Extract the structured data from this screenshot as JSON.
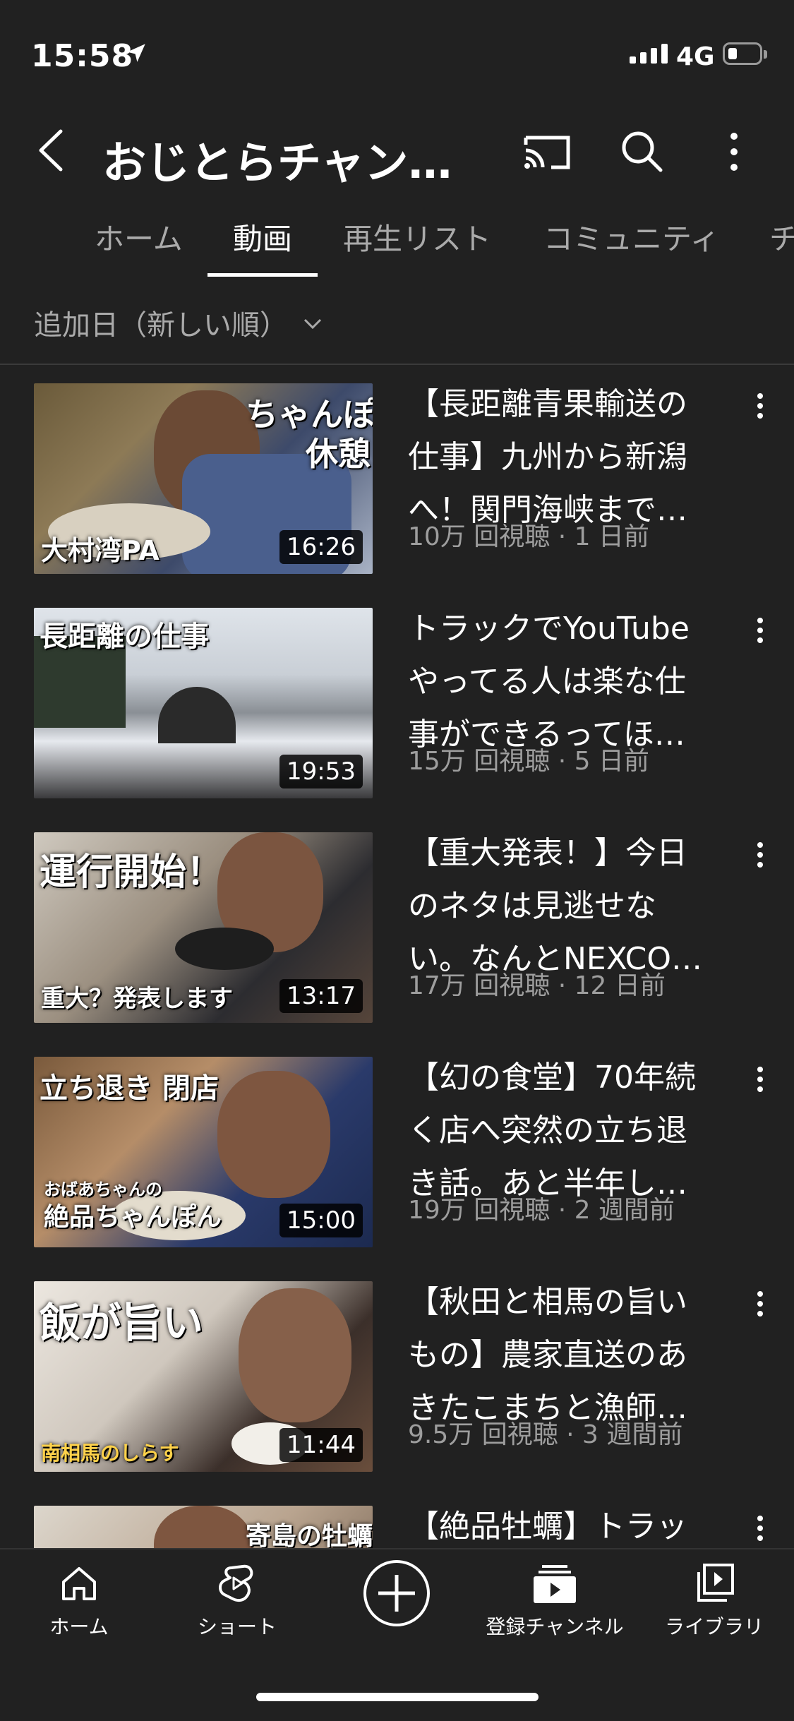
{
  "status_bar": {
    "time": "15:58",
    "network": "4G"
  },
  "header": {
    "title": "おじとらチャン…"
  },
  "tabs": [
    {
      "label": "ホーム"
    },
    {
      "label": "動画"
    },
    {
      "label": "再生リスト"
    },
    {
      "label": "コミュニティ"
    },
    {
      "label": "チ"
    }
  ],
  "active_tab": "動画",
  "sort": {
    "label": "追加日（新しい順）"
  },
  "videos": [
    {
      "title_lines": [
        "【長距離青果輸送の",
        "仕事】九州から新潟",
        "へ！関門海峡まで…"
      ],
      "meta": "10万 回視聴 · 1 日前",
      "duration": "16:26",
      "thumb_text": [
        "ちゃんぽん",
        "休憩",
        "大村湾PA"
      ]
    },
    {
      "title_lines": [
        "トラックでYouTube",
        "やってる人は楽な仕",
        "事ができるってほ…"
      ],
      "meta": "15万 回視聴 · 5 日前",
      "duration": "19:53",
      "thumb_text": [
        "長距離の仕事"
      ]
    },
    {
      "title_lines": [
        "【重大発表！】今日",
        "のネタは見逃せな",
        "い。なんとNEXCO…"
      ],
      "meta": "17万 回視聴 · 12 日前",
      "duration": "13:17",
      "thumb_text": [
        "運行開始！",
        "重大？発表します"
      ]
    },
    {
      "title_lines": [
        "【幻の食堂】70年続",
        "く店へ突然の立ち退",
        "き話。あと半年し…"
      ],
      "meta": "19万 回視聴 · 2 週間前",
      "duration": "15:00",
      "thumb_text": [
        "立ち退き 閉店",
        "おばあちゃんの",
        "絶品ちゃんぽん"
      ]
    },
    {
      "title_lines": [
        "【秋田と相馬の旨い",
        "もの】農家直送のあ",
        "きたこまちと漁師…"
      ],
      "meta": "9.5万 回視聴 · 3 週間前",
      "duration": "11:44",
      "thumb_text": [
        "飯が旨い",
        "南相馬のしらす"
      ]
    },
    {
      "title_lines": [
        "【絶品牡蠣】トラッ"
      ],
      "meta": "",
      "duration": "",
      "thumb_text": [
        "寄島の牡蠣"
      ]
    }
  ],
  "bottom_nav": [
    {
      "label": "ホーム",
      "icon": "home-icon"
    },
    {
      "label": "ショート",
      "icon": "shorts-icon"
    },
    {
      "label": "",
      "icon": "create-plus-icon"
    },
    {
      "label": "登録チャンネル",
      "icon": "subscriptions-icon"
    },
    {
      "label": "ライブラリ",
      "icon": "library-icon"
    }
  ],
  "colors": {
    "background": "#212121",
    "text_secondary": "#aaaaaa",
    "meta_text": "#9e9e9e"
  }
}
